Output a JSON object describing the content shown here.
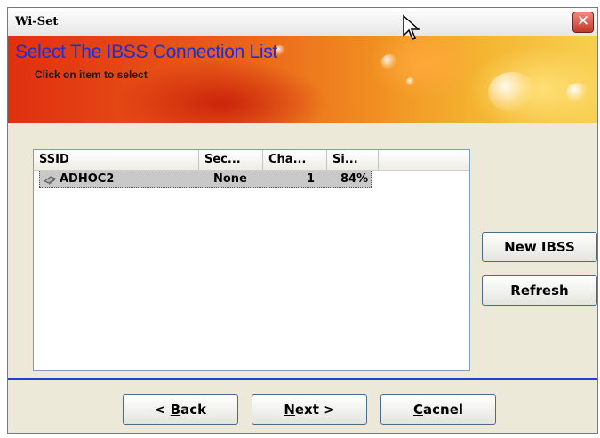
{
  "window": {
    "title": "Wi-Set",
    "close_glyph": "✕"
  },
  "banner": {
    "title": "Select The IBSS Connection List",
    "subtitle": "Click on item to select"
  },
  "list": {
    "columns": [
      "SSID",
      "Sec...",
      "Cha...",
      "Si..."
    ],
    "rows": [
      {
        "ssid": "ADHOC2",
        "security": "None",
        "channel": "1",
        "signal": "84%",
        "icon": "wireless-adhoc-icon"
      }
    ]
  },
  "side_buttons": {
    "new_ibss": "New IBSS",
    "refresh": "Refresh"
  },
  "nav": {
    "back_prefix": "< ",
    "back_mnemonic": "B",
    "back_rest": "ack",
    "next_mnemonic": "N",
    "next_rest": "ext >",
    "cancel_mnemonic": "C",
    "cancel_rest": "acnel"
  },
  "colors": {
    "accent_line": "#1f3fd6",
    "banner_title": "#1a2fd8"
  }
}
